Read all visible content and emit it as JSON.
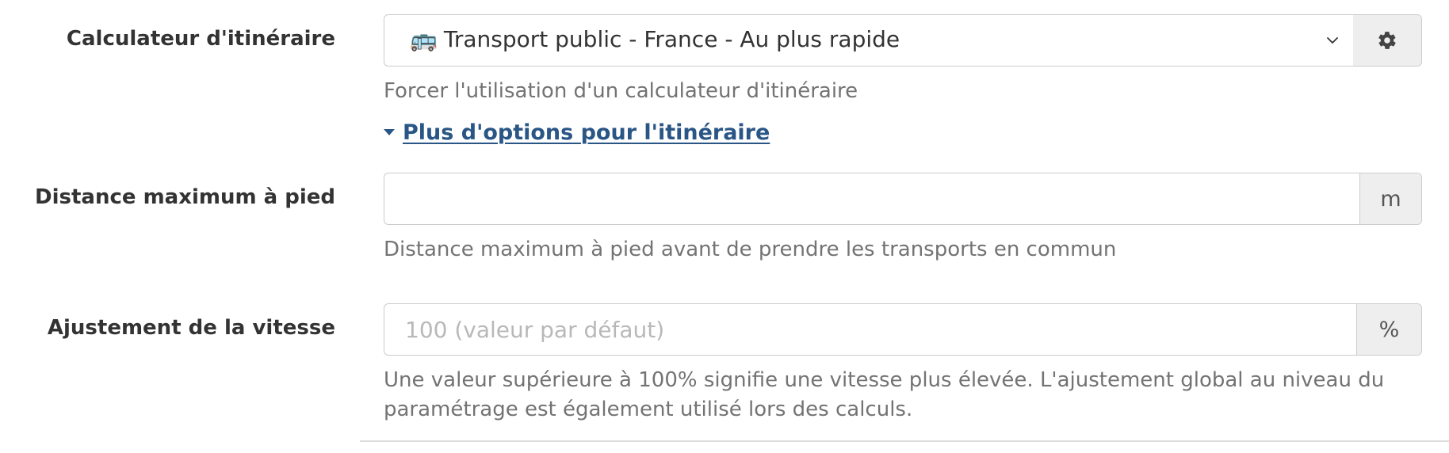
{
  "routing": {
    "label": "Calculateur d'itinéraire",
    "selected_emoji": "🚌",
    "selected_value": "Transport public - France - Au plus rapide",
    "help": "Forcer l'utilisation d'un calculateur d'itinéraire",
    "settings_icon": "gear-icon"
  },
  "more_options": {
    "label": "Plus d'options pour l'itinéraire",
    "icon": "caret-down-icon"
  },
  "max_walk": {
    "label": "Distance maximum à pied",
    "value": "",
    "unit": "m",
    "help": "Distance maximum à pied avant de prendre les transports en commun"
  },
  "speed": {
    "label": "Ajustement de la vitesse",
    "placeholder": "100 (valeur par défaut)",
    "value": "",
    "unit": "%",
    "help": "Une valeur supérieure à 100% signifie une vitesse plus élevée. L'ajustement global au niveau du paramétrage est également utilisé lors des calculs."
  },
  "colors": {
    "link": "#2a5686",
    "label": "#333333",
    "help_text": "#737373",
    "addon_background": "#eeeeee",
    "border": "#cccccc"
  }
}
